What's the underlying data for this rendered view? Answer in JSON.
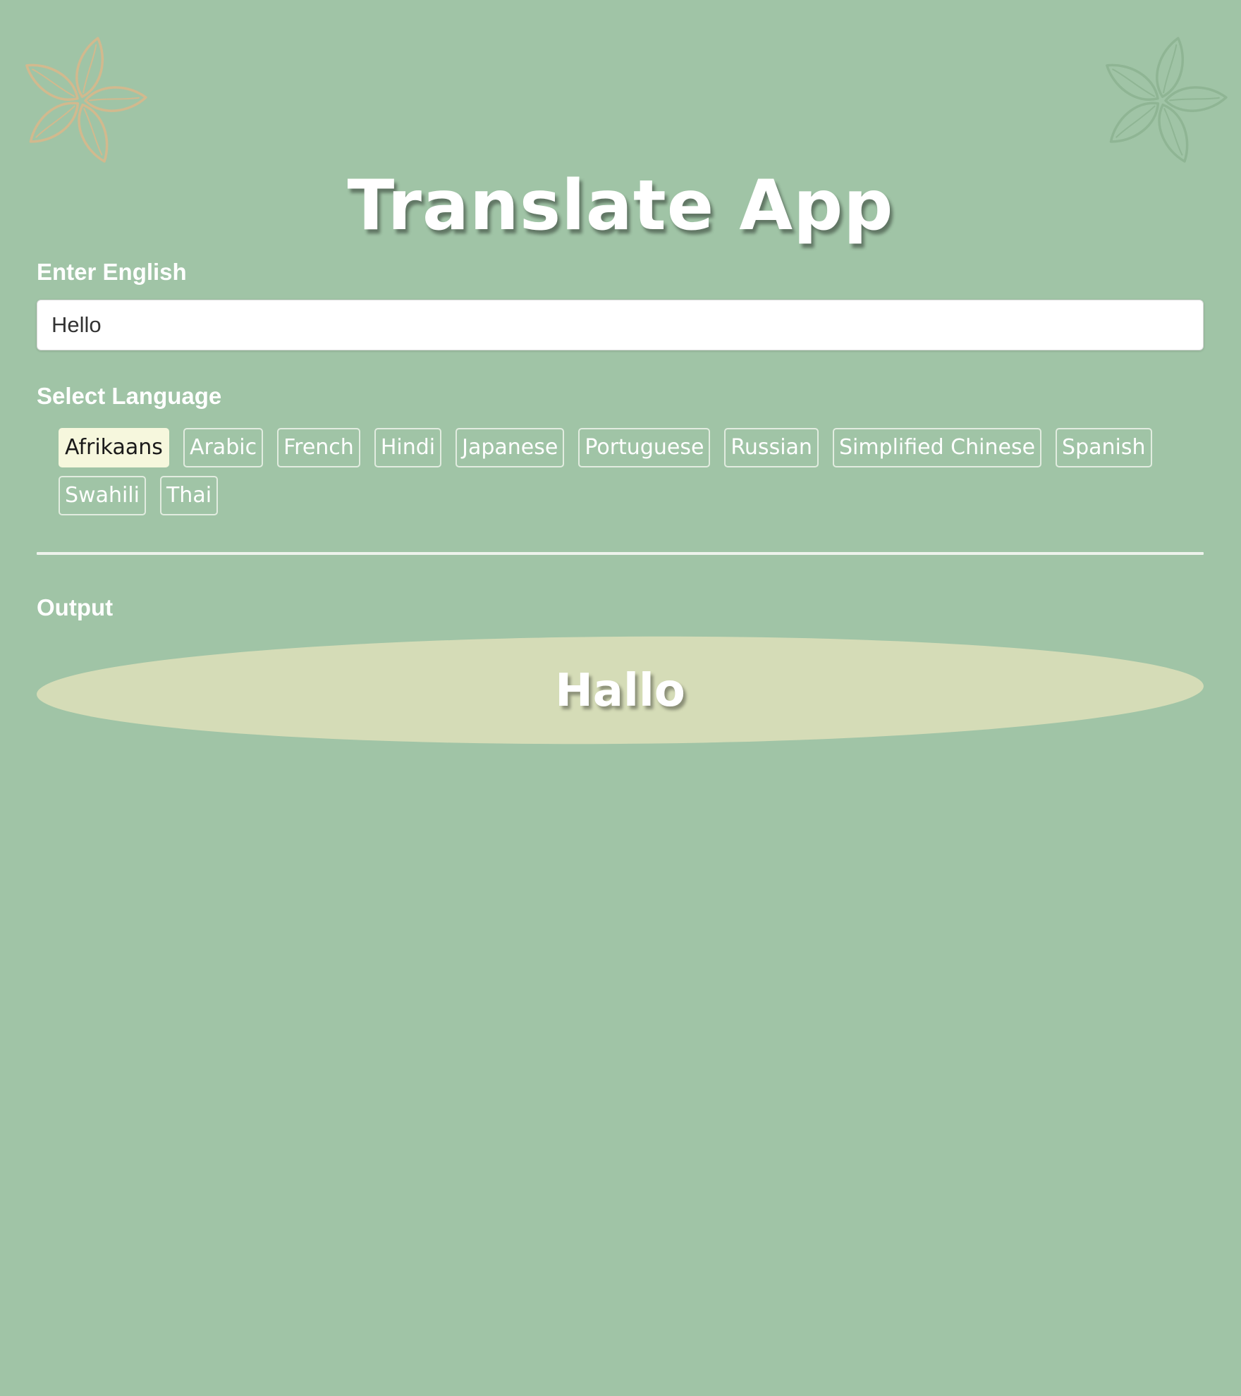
{
  "app": {
    "title": "Translate App"
  },
  "input_section": {
    "label": "Enter English",
    "value": "Hello"
  },
  "language_section": {
    "label": "Select Language",
    "selected": "Afrikaans",
    "languages": [
      "Afrikaans",
      "Arabic",
      "French",
      "Hindi",
      "Japanese",
      "Portuguese",
      "Russian",
      "Simplified Chinese",
      "Spanish",
      "Swahili",
      "Thai"
    ]
  },
  "output_section": {
    "label": "Output",
    "text": "Hallo"
  },
  "decorations": {
    "left_flower": "flower-icon",
    "right_flower": "flower-icon"
  },
  "colors": {
    "background": "#a0c4a6",
    "left_flower_stroke": "#d2b98e",
    "right_flower_stroke": "#8fb594",
    "selected_button_bg": "#f6f7dd",
    "output_blob": "#d5dcb7",
    "text": "#ffffff"
  }
}
